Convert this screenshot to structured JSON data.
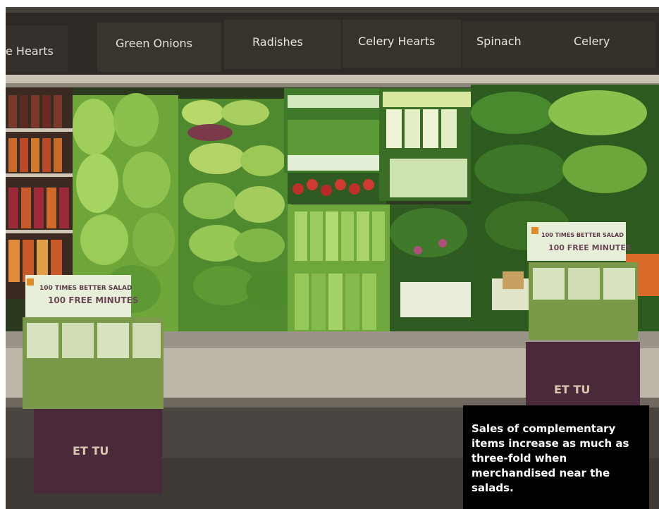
{
  "signs": [
    "e Hearts",
    "Green Onions",
    "Radishes",
    "Celery Hearts",
    "Spinach",
    "Celery"
  ],
  "display_box_text": {
    "headline_left": "100 TIMES BETTER SALAD",
    "subline_left": "100 FREE MINUTES",
    "headline_right": "100 TIMES BETTER SALAD",
    "subline_right": "100 FREE MINUTES",
    "brand_left": "ET TU",
    "brand_right": "ET TU"
  },
  "caption": "Sales of complementary items increase as much as three-fold when merchandised near the salads.",
  "colors": {
    "sign_bg": "#35302c",
    "shelf_trim": "#c9c3b4",
    "produce_light": "#9fce5a",
    "produce_dark": "#3f7a2a",
    "box_purple": "#4a2a3a",
    "caption_bg": "#000000"
  }
}
